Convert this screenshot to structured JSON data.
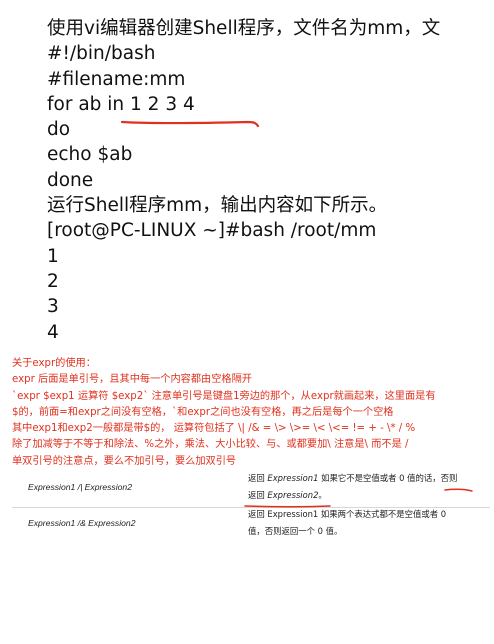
{
  "script_block": {
    "lines": [
      "使用vi编辑器创建Shell程序，文件名为mm，文",
      "#!/bin/bash",
      "#filename:mm",
      "for ab in 1 2 3 4",
      "do",
      "echo $ab",
      "done",
      "运行Shell程序mm，输出内容如下所示。",
      "[root@PC-LINUX ~]#bash /root/mm",
      "1",
      "2",
      "3",
      "4"
    ]
  },
  "notes": {
    "lines": [
      "关于expr的使用：",
      "expr 后面是单引号，且其中每一个内容都由空格隔开",
      "`expr $exp1 运算符 $exp2` 注意单引号是键盘1旁边的那个，从expr就画起来，这里面是有",
      "$的，前面=和expr之间没有空格，`和expr之间也没有空格，再之后是每个一个空格",
      "其中exp1和exp2一般都是带$的， 运算符包括了 \\| /& = \\> \\>= \\< \\<= != + - \\* / %",
      "除了加减等于不等于和除法、%之外，乘法、大小比较、与、或都要加\\ 注意是\\ 而不是 /",
      "单双引号的注意点，要么不加引号，要么加双引号"
    ]
  },
  "expr_table": {
    "rows": [
      {
        "syntax": "Expression1 /| Expression2",
        "desc_line1_prefix": "返回 ",
        "desc_line1_ital": "Expression1",
        "desc_line1_suffix": " 如果它不是空值或者 0 值的话，否则",
        "desc_line2_prefix": "返回 ",
        "desc_line2_ital": "Expression2",
        "desc_line2_suffix": "。"
      },
      {
        "syntax": "Expression1 /& Expression2",
        "desc_line1": "返回 Expression1 如果两个表达式都不是空值或者 0",
        "desc_line2": "值，否则返回一个 0 值。"
      }
    ]
  },
  "colors": {
    "note_text": "#e0301e",
    "annotation": "#e0301e",
    "body_text": "#111111"
  }
}
